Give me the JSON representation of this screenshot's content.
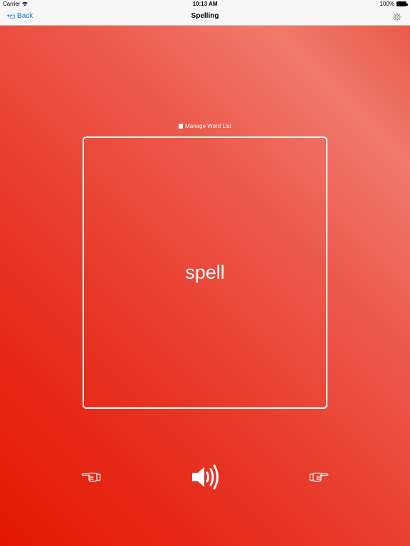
{
  "status_bar": {
    "carrier": "Carrier",
    "time": "10:13 AM",
    "battery_percent": "100%"
  },
  "nav_bar": {
    "back_label": "Back",
    "title": "Spelling",
    "icons": [
      "pointing-hand-left-icon",
      "gear-icon"
    ]
  },
  "main": {
    "manage_word_list_label": "Manage Word List",
    "current_word": "spell",
    "icons": [
      "book-icon",
      "pointing-hand-left-icon",
      "speaker-icon",
      "pointing-hand-right-icon"
    ]
  },
  "colors": {
    "accent": "#1a73e8",
    "background_start": "#e41602",
    "background_end": "#f07a6c",
    "foreground": "#ffffff"
  }
}
